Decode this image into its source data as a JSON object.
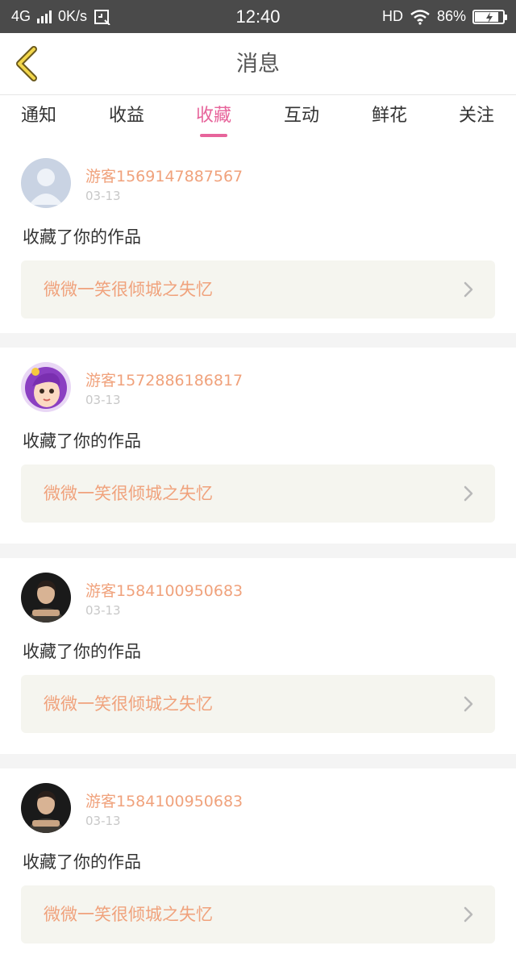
{
  "status_bar": {
    "network": "4G",
    "speed": "0K/s",
    "time": "12:40",
    "hd": "HD",
    "battery": "86%",
    "battery_level": 0.86
  },
  "header": {
    "title": "消息"
  },
  "tabs": [
    {
      "label": "通知",
      "active": false
    },
    {
      "label": "收益",
      "active": false
    },
    {
      "label": "收藏",
      "active": true
    },
    {
      "label": "互动",
      "active": false
    },
    {
      "label": "鲜花",
      "active": false
    },
    {
      "label": "关注",
      "active": false
    }
  ],
  "accent_color": "#e7649b",
  "name_color": "#f0a27c",
  "messages": [
    {
      "user": "游客1569147887567",
      "date": "03-13",
      "action": "收藏了你的作品",
      "work": "微微一笑很倾城之失忆",
      "avatar": "default-avatar-icon"
    },
    {
      "user": "游客1572886186817",
      "date": "03-13",
      "action": "收藏了你的作品",
      "work": "微微一笑很倾城之失忆",
      "avatar": "cartoon-girl-avatar"
    },
    {
      "user": "游客1584100950683",
      "date": "03-13",
      "action": "收藏了你的作品",
      "work": "微微一笑很倾城之失忆",
      "avatar": "photo-man-avatar"
    },
    {
      "user": "游客1584100950683",
      "date": "03-13",
      "action": "收藏了你的作品",
      "work": "微微一笑很倾城之失忆",
      "avatar": "photo-man-avatar"
    }
  ]
}
